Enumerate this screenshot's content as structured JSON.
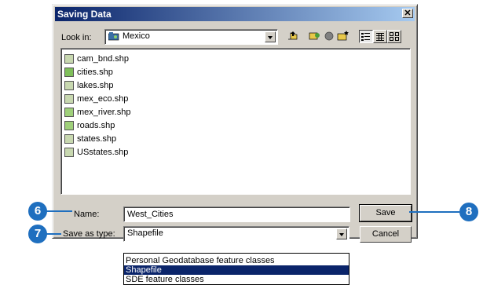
{
  "dialog": {
    "title": "Saving Data",
    "close_symbol": "✕",
    "look_in_label": "Look in:",
    "look_in_value": "Mexico",
    "toolbar_buttons": [
      "up-one-level",
      "connect-to-folder",
      "disconnect-folder",
      "new-folder",
      "list-view",
      "details-view",
      "thumbnails-view"
    ]
  },
  "files": [
    {
      "name": "cam_bnd.shp",
      "icon": "polygon-shapefile-icon"
    },
    {
      "name": "cities.shp",
      "icon": "point-shapefile-icon"
    },
    {
      "name": "lakes.shp",
      "icon": "polygon-shapefile-icon"
    },
    {
      "name": "mex_eco.shp",
      "icon": "polygon-shapefile-icon"
    },
    {
      "name": "mex_river.shp",
      "icon": "line-shapefile-icon"
    },
    {
      "name": "roads.shp",
      "icon": "line-shapefile-icon"
    },
    {
      "name": "states.shp",
      "icon": "polygon-shapefile-icon"
    },
    {
      "name": "USstates.shp",
      "icon": "polygon-shapefile-icon"
    }
  ],
  "form": {
    "name_label": "Name:",
    "name_value": "West_Cities",
    "type_label": "Save as type:",
    "type_value": "Shapefile",
    "save_label": "Save",
    "cancel_label": "Cancel"
  },
  "type_options": [
    "Personal Geodatabase feature classes",
    "Shapefile",
    "SDE feature classes"
  ],
  "selected_option": "Shapefile",
  "callouts": [
    "6",
    "7",
    "8"
  ],
  "colors": {
    "title_bar": "#0a246a",
    "callout": "#1f6fbf",
    "selection": "#0a246a"
  }
}
